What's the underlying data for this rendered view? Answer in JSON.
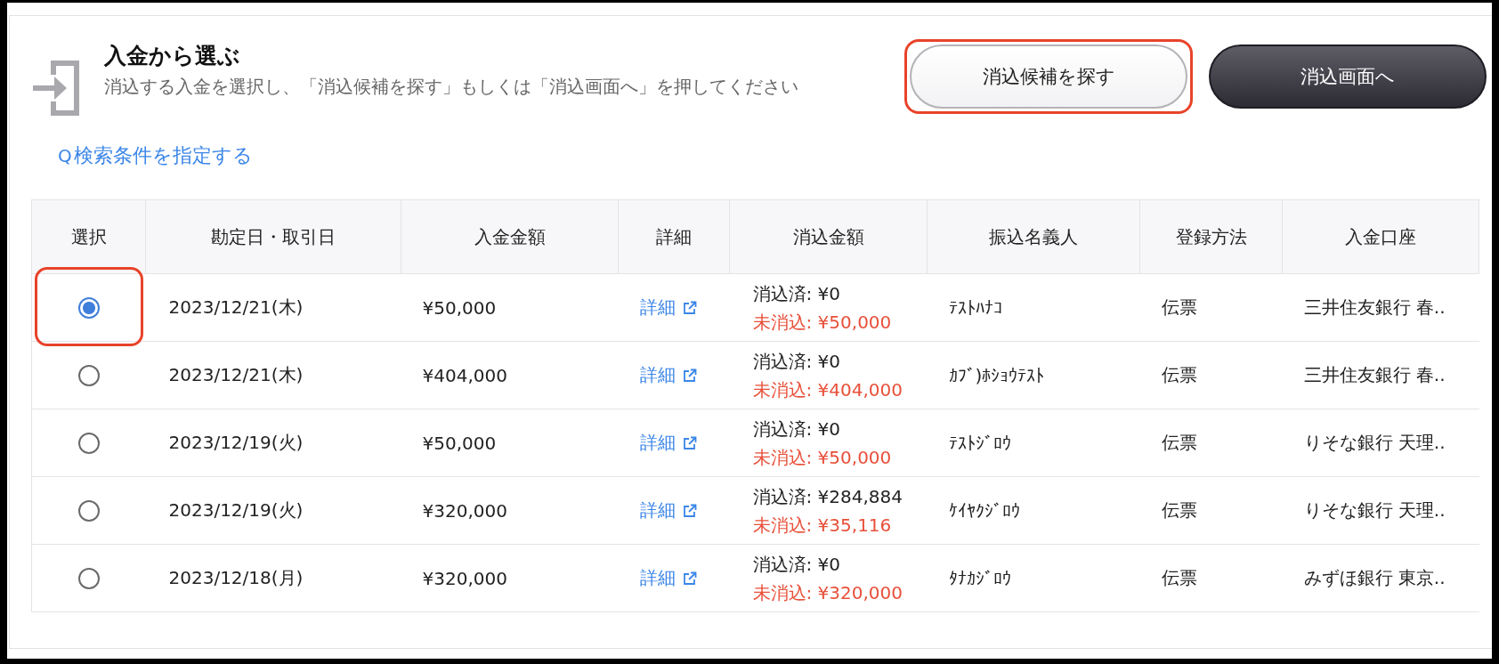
{
  "header": {
    "title": "入金から選ぶ",
    "description": "消込する入金を選択し、「消込候補を探す」もしくは「消込画面へ」を押してください"
  },
  "buttons": [
    {
      "label": "消込候補を探す",
      "kind": "secondary",
      "highlighted": true
    },
    {
      "label": "消込画面へ",
      "kind": "primary",
      "highlighted": false
    }
  ],
  "search_link": {
    "icon": "Q",
    "label": "検索条件を指定する"
  },
  "table": {
    "columns": [
      "選択",
      "勘定日・取引日",
      "入金金額",
      "詳細",
      "消込金額",
      "振込名義人",
      "登録方法",
      "入金口座"
    ],
    "rows": [
      {
        "selected": true,
        "highlighted": true,
        "date": "2023/12/21(木)",
        "amount": "¥50,000",
        "detail": "詳細",
        "cleared": "消込済: ¥0",
        "uncleared": "未消込: ¥50,000",
        "payer": "ﾃｽﾄﾊﾅｺ",
        "method": "伝票",
        "account": "三井住友銀行 春.."
      },
      {
        "selected": false,
        "highlighted": false,
        "date": "2023/12/21(木)",
        "amount": "¥404,000",
        "detail": "詳細",
        "cleared": "消込済: ¥0",
        "uncleared": "未消込: ¥404,000",
        "payer": "ｶﾌﾞ)ﾎｼｮｳﾃｽﾄ",
        "method": "伝票",
        "account": "三井住友銀行 春.."
      },
      {
        "selected": false,
        "highlighted": false,
        "date": "2023/12/19(火)",
        "amount": "¥50,000",
        "detail": "詳細",
        "cleared": "消込済: ¥0",
        "uncleared": "未消込: ¥50,000",
        "payer": "ﾃｽﾄｼﾞﾛｳ",
        "method": "伝票",
        "account": "りそな銀行 天理.."
      },
      {
        "selected": false,
        "highlighted": false,
        "date": "2023/12/19(火)",
        "amount": "¥320,000",
        "detail": "詳細",
        "cleared": "消込済: ¥284,884",
        "uncleared": "未消込: ¥35,116",
        "payer": "ｹｲﾔｸｼﾞﾛｳ",
        "method": "伝票",
        "account": "りそな銀行 天理.."
      },
      {
        "selected": false,
        "highlighted": false,
        "date": "2023/12/18(月)",
        "amount": "¥320,000",
        "detail": "詳細",
        "cleared": "消込済: ¥0",
        "uncleared": "未消込: ¥320,000",
        "payer": "ﾀﾅｶｼﾞﾛｳ",
        "method": "伝票",
        "account": "みずほ銀行 東京.."
      }
    ]
  }
}
